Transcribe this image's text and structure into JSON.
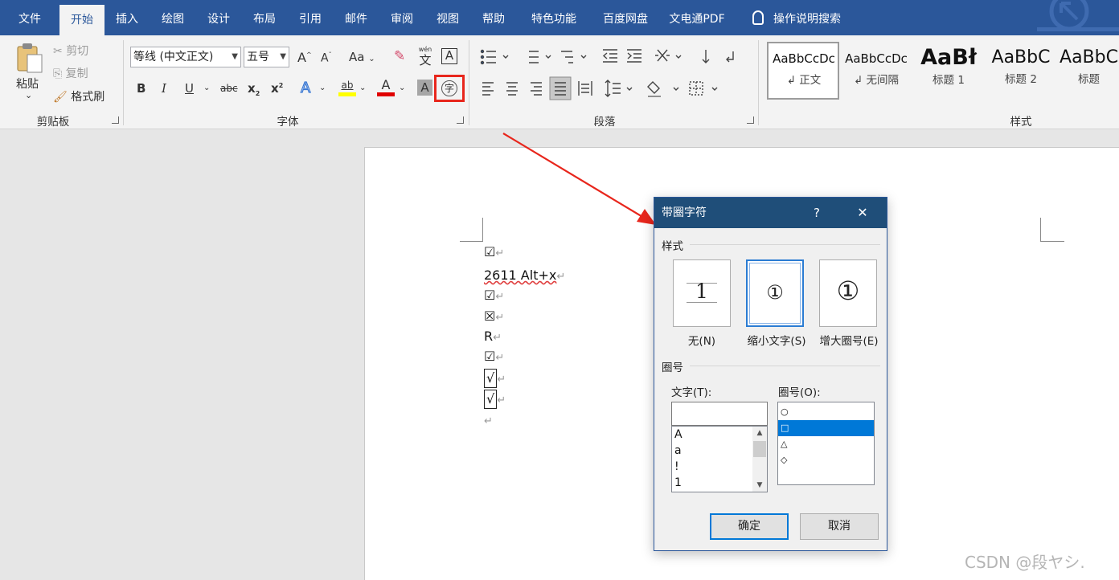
{
  "tabs": [
    "文件",
    "开始",
    "插入",
    "绘图",
    "设计",
    "布局",
    "引用",
    "邮件",
    "审阅",
    "视图",
    "帮助",
    "特色功能",
    "百度网盘",
    "文电通PDF"
  ],
  "active_tab": "开始",
  "tell_me": "操作说明搜索",
  "clipboard": {
    "paste": "粘贴",
    "cut": "剪切",
    "copy": "复制",
    "format_painter": "格式刷",
    "group_label": "剪贴板"
  },
  "font": {
    "font_name": "等线 (中文正文)",
    "font_size": "五号",
    "group_label": "字体",
    "grow": "A",
    "shrink": "A",
    "change_case": "Aa",
    "phonetic": "wén",
    "phonetic_char": "文",
    "char_border": "A",
    "bold": "B",
    "italic": "I",
    "underline": "U",
    "strikethrough": "abc",
    "subscript": "x",
    "superscript": "x",
    "text_effects": "A",
    "highlight": "ab",
    "font_color": "A",
    "char_shading": "A",
    "enclose": "字"
  },
  "paragraph": {
    "group_label": "段落"
  },
  "styles": {
    "group_label": "样式",
    "items": [
      {
        "sample": "AaBbCcDc",
        "name": "↲ 正文"
      },
      {
        "sample": "AaBbCcDc",
        "name": "↲ 无间隔"
      },
      {
        "sample": "AaBł",
        "name": "标题 1"
      },
      {
        "sample": "AaBbC",
        "name": "标题 2"
      },
      {
        "sample": "AaBbC",
        "name": "标题"
      }
    ]
  },
  "document": {
    "lines": [
      {
        "text": "☑",
        "mark": "↵"
      },
      {
        "text": "2611 Alt+x",
        "mark": "↵"
      },
      {
        "text": "☑",
        "mark": "↵"
      },
      {
        "text": "☒",
        "mark": "↵"
      },
      {
        "text": "R",
        "mark": "↵"
      },
      {
        "text": "☑",
        "mark": "↵"
      },
      {
        "text": "√",
        "mark": "↵"
      },
      {
        "text": "√",
        "mark": "↵"
      },
      {
        "text": "",
        "mark": "↵"
      }
    ]
  },
  "dialog": {
    "title": "带圈字符",
    "help": "?",
    "close": "✕",
    "style_section": "样式",
    "options": [
      {
        "label": "无(N)",
        "glyph": "1"
      },
      {
        "label": "缩小文字(S)",
        "glyph": "①"
      },
      {
        "label": "增大圈号(E)",
        "glyph": "①"
      }
    ],
    "enclosure_section": "圈号",
    "text_label": "文字(T):",
    "text_value": "",
    "text_items": [
      "A",
      "a",
      "!",
      "1"
    ],
    "enclosure_label": "圈号(O):",
    "enclosure_items": [
      "○",
      "□",
      "△",
      "◇"
    ],
    "selected_enclosure": "□",
    "ok": "确定",
    "cancel": "取消"
  },
  "watermark": "CSDN @段ヤシ."
}
